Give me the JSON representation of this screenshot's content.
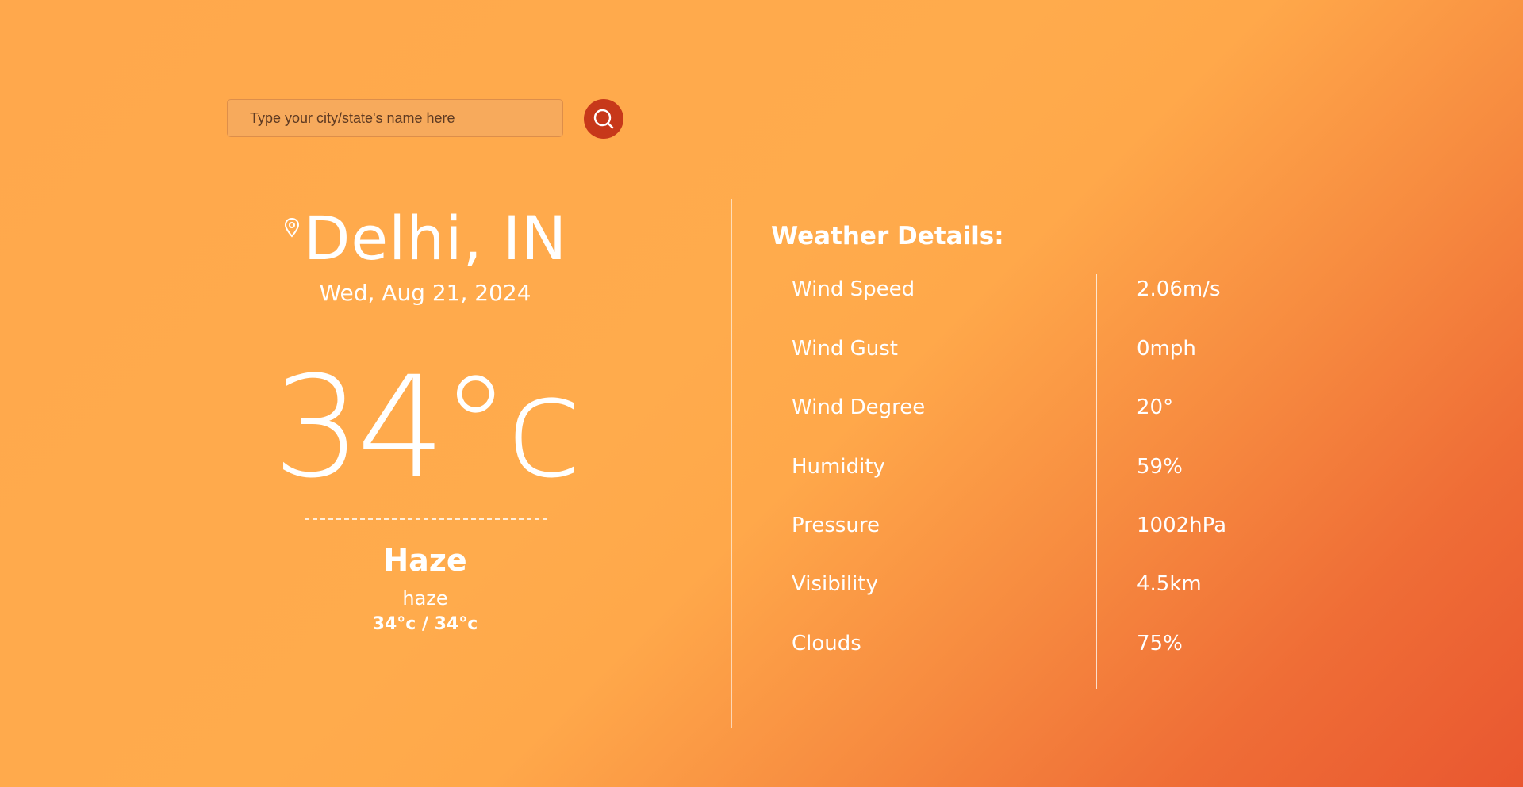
{
  "search": {
    "placeholder": "Type your city/state's name here",
    "button_icon": "search-icon"
  },
  "location": {
    "icon": "location-pin-icon",
    "city": "Delhi, IN",
    "date": "Wed, Aug 21, 2024"
  },
  "current": {
    "temperature": "34°c",
    "condition": "Haze",
    "description": "haze",
    "minmax": "34°c / 34°c"
  },
  "details": {
    "title": "Weather Details:",
    "rows": [
      {
        "label": "Wind Speed",
        "value": "2.06m/s"
      },
      {
        "label": "Wind Gust",
        "value": "0mph"
      },
      {
        "label": "Wind Degree",
        "value": "20°"
      },
      {
        "label": "Humidity",
        "value": "59%"
      },
      {
        "label": "Pressure",
        "value": "1002hPa"
      },
      {
        "label": "Visibility",
        "value": "4.5km"
      },
      {
        "label": "Clouds",
        "value": "75%"
      }
    ]
  },
  "colors": {
    "background_start": "#ffa84c",
    "background_end": "#e95730",
    "search_button": "#c7381a",
    "text": "#ffffff"
  }
}
